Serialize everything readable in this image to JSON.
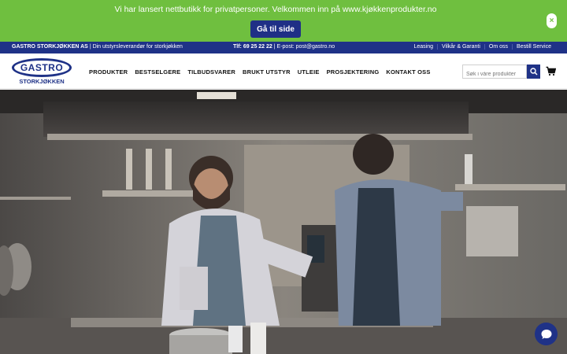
{
  "promo": {
    "text": "Vi har lansert nettbutikk for privatpersoner. Velkommen inn på www.kjøkkenprodukter.no",
    "button_label": "Gå til side",
    "close_glyph": "×",
    "background": "#6fbf3f"
  },
  "topbar": {
    "company_name": "GASTRO STORKJØKKEN AS",
    "company_tagline": "| Din utstyrsleverandør for storkjøkken",
    "phone": "Tlf: 69 25 22 22",
    "email": "| E-post: post@gastro.no",
    "links": [
      "Leasing",
      "Vilkår & Garanti",
      "Om oss",
      "Bestill Service"
    ],
    "background": "#1f3287"
  },
  "logo": {
    "main": "GASTRO",
    "sub": "STORKJØKKEN"
  },
  "nav": {
    "items": [
      "PRODUKTER",
      "BESTSELGERE",
      "TILBUDSVARER",
      "BRUKT UTSTYR",
      "UTLEIE",
      "PROSJEKTERING",
      "KONTAKT OSS"
    ]
  },
  "search": {
    "placeholder": "Søk i våre produkter",
    "icon": "search-icon"
  },
  "cart": {
    "icon": "cart-icon"
  },
  "hero": {
    "scene": "chefs-in-kitchen-photo"
  },
  "chat": {
    "icon": "chat-icon"
  }
}
